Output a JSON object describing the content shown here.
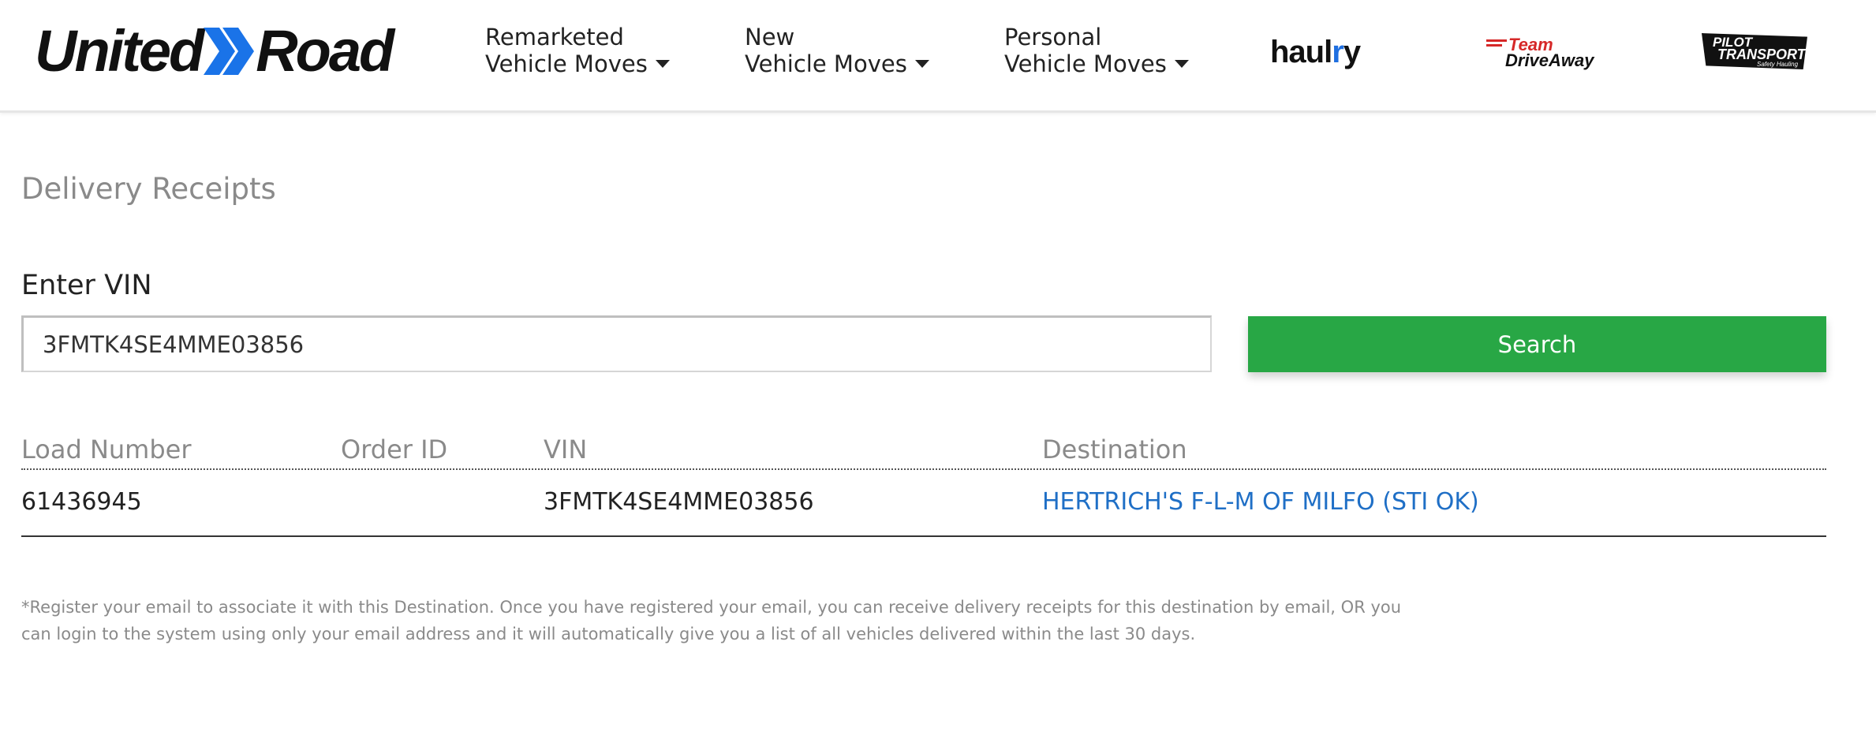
{
  "header": {
    "logo": {
      "left_text": "United",
      "right_text": "Road",
      "accent_color": "#1a73e8"
    },
    "nav": [
      {
        "line1": "Remarketed",
        "line2": "Vehicle Moves"
      },
      {
        "line1": "New",
        "line2": "Vehicle Moves"
      },
      {
        "line1": "Personal",
        "line2": "Vehicle Moves"
      }
    ],
    "brands": {
      "haulry": {
        "text_a": "haul",
        "text_b": "r",
        "text_c": "y"
      },
      "team_driveaway": {
        "line1": "Team",
        "line2": "DriveAway"
      },
      "pilot": {
        "line1": "PILOT",
        "line2": "TRANSPORT",
        "tagline": "Safety Hauling Specialists"
      }
    }
  },
  "main": {
    "title": "Delivery Receipts",
    "vin_label": "Enter VIN",
    "vin_value": "3FMTK4SE4MME03856",
    "search_label": "Search",
    "search_color": "#28a745",
    "table": {
      "headers": {
        "load": "Load Number",
        "order": "Order ID",
        "vin": "VIN",
        "dest": "Destination"
      },
      "rows": [
        {
          "load": "61436945",
          "order": "",
          "vin": "3FMTK4SE4MME03856",
          "dest": "HERTRICH'S F-L-M OF MILFO (STI OK)"
        }
      ]
    },
    "footnote": "*Register your email to associate it with this Destination. Once you have registered your email, you can receive delivery receipts for this destination by email, OR you can login to the system using only your email address and it will automatically give you a list of all vehicles delivered within the last 30 days."
  }
}
